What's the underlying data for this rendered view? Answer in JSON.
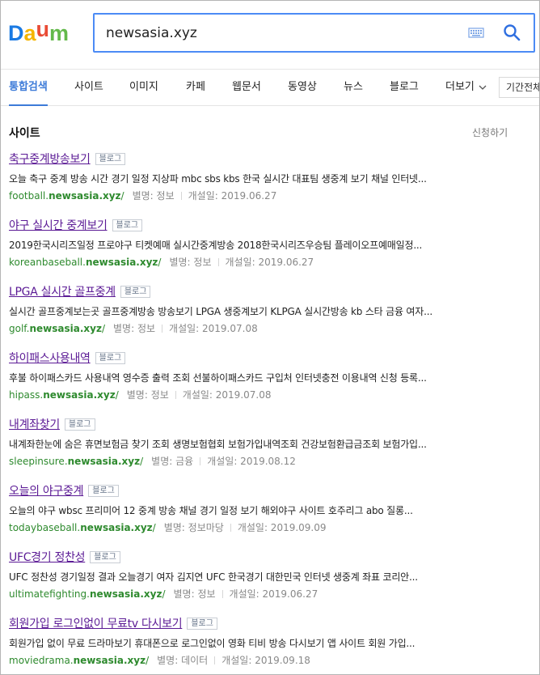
{
  "header": {
    "logo_text": "Daum",
    "search_value": "newsasia.xyz"
  },
  "tabs": [
    {
      "label": "통합검색"
    },
    {
      "label": "사이트"
    },
    {
      "label": "이미지"
    },
    {
      "label": "카페"
    },
    {
      "label": "웹문서"
    },
    {
      "label": "동영상"
    },
    {
      "label": "뉴스"
    },
    {
      "label": "블로그"
    },
    {
      "label": "더보기"
    }
  ],
  "period_label": "기간전체",
  "section": {
    "title": "사이트",
    "request_link": "신청하기"
  },
  "results": [
    {
      "title": "축구중계방송보기",
      "badge": "블로그",
      "desc": "오늘 축구 중계 방송 시간 경기 일정 지상파 mbc sbs kbs 한국 실시간 대표팀 생중계 보기 채널 인터넷...",
      "url_prefix": "football.",
      "url_domain": "newsasia.xyz",
      "url_suffix": "/",
      "alias_label": "별명:",
      "alias": "정보",
      "opened": "개설일: 2019.06.27"
    },
    {
      "title": "야구 실시간 중계보기",
      "badge": "블로그",
      "desc": "2019한국시리즈일정 프로야구 티켓예매 실시간중계방송 2018한국시리즈우승팀 플레이오프예매일정...",
      "url_prefix": "koreanbaseball.",
      "url_domain": "newsasia.xyz",
      "url_suffix": "/",
      "alias_label": "별명:",
      "alias": "정보",
      "opened": "개설일: 2019.06.27"
    },
    {
      "title": "LPGA 실시간 골프중계",
      "badge": "블로그",
      "desc": "실시간 골프중계보는곳 골프중계방송 방송보기 LPGA 생중계보기 KLPGA 실시간방송 kb 스타 금융 여자...",
      "url_prefix": "golf.",
      "url_domain": "newsasia.xyz",
      "url_suffix": "/",
      "alias_label": "별명:",
      "alias": "정보",
      "opened": "개설일: 2019.07.08"
    },
    {
      "title": "하이패스사용내역",
      "badge": "블로그",
      "desc": "후불 하이패스카드 사용내역 영수증 출력 조회 선불하이패스카드 구입처 인터넷충전 이용내역 신청 등록...",
      "url_prefix": "hipass.",
      "url_domain": "newsasia.xyz",
      "url_suffix": "/",
      "alias_label": "별명:",
      "alias": "정보",
      "opened": "개설일: 2019.07.08"
    },
    {
      "title": "내계좌찾기",
      "badge": "블로그",
      "desc": "내계좌한눈에 숨은 휴면보험금 찾기 조회 생명보험협회 보험가입내역조회 건강보험환급금조회 보험가입...",
      "url_prefix": "sleepinsure.",
      "url_domain": "newsasia.xyz",
      "url_suffix": "/",
      "alias_label": "별명:",
      "alias": "금융",
      "opened": "개설일: 2019.08.12"
    },
    {
      "title": "오늘의 야구중계",
      "badge": "블로그",
      "desc": "오늘의 야구 wbsc 프리미어 12 중계 방송 채널 경기 일정 보기 해외야구 사이트 호주리그 abo 질롱...",
      "url_prefix": "todaybaseball.",
      "url_domain": "newsasia.xyz",
      "url_suffix": "/",
      "alias_label": "별명:",
      "alias": "정보마당",
      "opened": "개설일: 2019.09.09"
    },
    {
      "title": "UFC경기 정찬성",
      "badge": "블로그",
      "desc": "UFC 정찬성 경기일정 결과 오늘경기 여자 김지연 UFC 한국경기 대한민국 인터넷 생중계 좌표 코리안...",
      "url_prefix": "ultimatefighting.",
      "url_domain": "newsasia.xyz",
      "url_suffix": "/",
      "alias_label": "별명:",
      "alias": "정보",
      "opened": "개설일: 2019.06.27"
    },
    {
      "title": "회원가입 로그인없이 무료tv 다시보기",
      "badge": "블로그",
      "desc": "회원가입 없이 무료 드라마보기 휴대폰으로 로그인없이 영화 티비 방송 다시보기 앱 사이트 회원 가입...",
      "url_prefix": "moviedrama.",
      "url_domain": "newsasia.xyz",
      "url_suffix": "/",
      "alias_label": "별명:",
      "alias": "데이터",
      "opened": "개설일: 2019.09.18"
    }
  ],
  "colors": {
    "accent": "#3d7bd8",
    "visited_link": "#5b1a95",
    "url_green": "#2e8a2e"
  }
}
